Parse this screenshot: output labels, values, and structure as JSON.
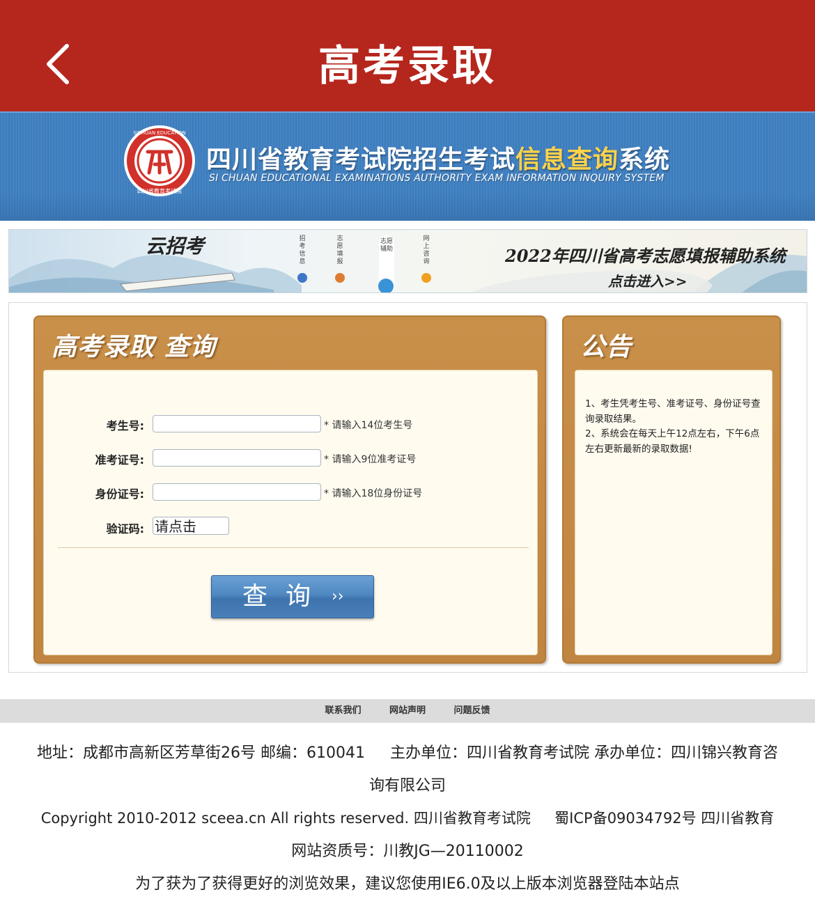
{
  "topbar": {
    "back_icon": "chevron-left-icon",
    "title": "高考录取"
  },
  "header": {
    "title_main": "四川省教育考试院招生考试",
    "title_highlight": "信息查询",
    "title_tail": "系统",
    "subtitle": "SI CHUAN EDUCATIONAL EXAMINATIONS AUTHORITY EXAM INFORMATION INQUIRY SYSTEM",
    "accent_color": "#ffd24a"
  },
  "banner": {
    "logo_text": "云招考",
    "tabs": [
      {
        "label": "招考信息",
        "color": "#3f77c8"
      },
      {
        "label": "志愿填报",
        "color": "#e07c32"
      },
      {
        "label": "志愿辅助",
        "color": "#3a93d6"
      },
      {
        "label": "网上咨询",
        "color": "#f0a020"
      }
    ],
    "text_line1": "2022年四川省高考志愿填报辅助系统",
    "text_line2": "点击进入>>"
  },
  "query": {
    "title": "高考录取 查询",
    "fields": [
      {
        "label": "考生号:",
        "value": "",
        "hint": "* 请输入14位考生号"
      },
      {
        "label": "准考证号:",
        "value": "",
        "hint": "* 请输入9位准考证号"
      },
      {
        "label": "身份证号:",
        "value": "",
        "hint": "* 请输入18位身份证号"
      }
    ],
    "captcha_label": "验证码:",
    "captcha_text": "请点击",
    "submit_label": "查询",
    "submit_arrow": "››"
  },
  "notice": {
    "title": "公告",
    "lines": [
      "1、考生凭考生号、准考证号、身份证号查询录取结果。",
      "2、系统会在每天上午12点左右，下午6点左右更新最新的录取数据!"
    ]
  },
  "footer": {
    "links": [
      "联系我们",
      "网站声明",
      "问题反馈"
    ],
    "info_lines": [
      "地址：成都市高新区芳草街26号 邮编：610041 　 主办单位：四川省教育考试院 承办单位：四川锦兴教育咨",
      "询有限公司",
      "Copyright 2010-2012 sceea.cn All rights reserved. 四川省教育考试院 　 蜀ICP备09034792号 四川省教育",
      "网站资质号：川教JG—20110002",
      "为了获为了获得更好的浏览效果，建议您使用IE6.0及以上版本浏览器登陆本站点"
    ]
  },
  "colors": {
    "topbar": "#b5261d",
    "header_blue": "#4684c2",
    "panel_orange": "#c9904a",
    "panel_inner": "#fffbef",
    "button_blue": "#4f87c1"
  }
}
